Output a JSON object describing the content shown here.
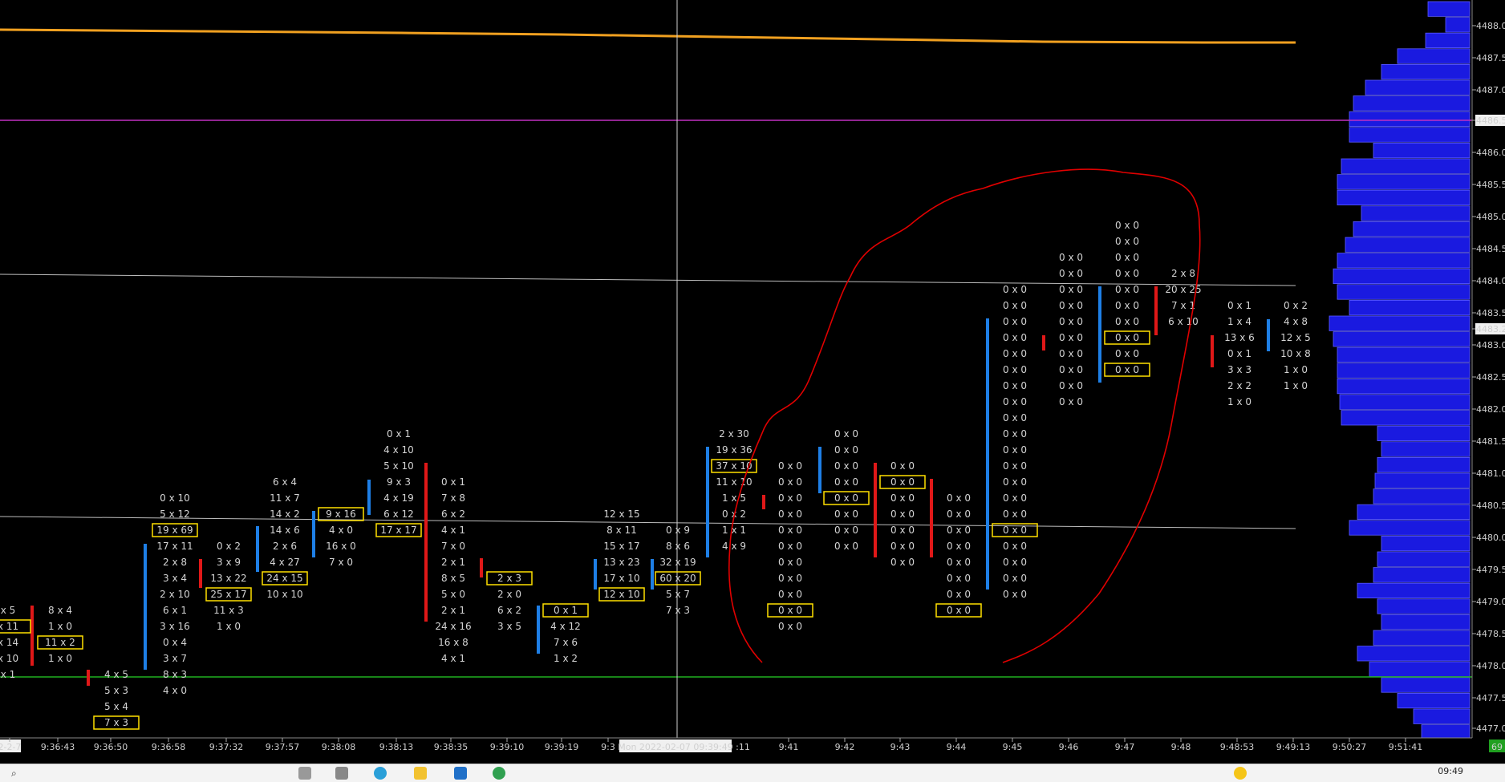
{
  "price_axis": {
    "labels": [
      "4488.00",
      "4487.50",
      "4487.00",
      "4486.50",
      "4486.00",
      "4485.50",
      "4485.00",
      "4484.50",
      "4484.00",
      "4483.50",
      "4483.25",
      "4483.00",
      "4482.50",
      "4482.00",
      "4481.50",
      "4481.00",
      "4480.50",
      "4480.00",
      "4479.50",
      "4479.00",
      "4478.50",
      "4478.00",
      "4477.50",
      "4477.00"
    ],
    "highlight_labels": [
      "4486.50",
      "4483.25"
    ]
  },
  "time_axis": {
    "labels": [
      "2-2-7",
      "9:36:43",
      "9:36:50",
      "9:36:58",
      "9:37:32",
      "9:37:57",
      "9:38:08",
      "9:38:13",
      "9:38:35",
      "9:39:10",
      "9:39:19",
      "9:3",
      "9:41",
      "9:42",
      "9:43",
      "9:44",
      "9:45",
      "9:46",
      "9:47",
      "9:48",
      "9:48:53",
      "9:49:13",
      "9:50:27",
      "9:51:41"
    ],
    "crosshair_label": "Mon 2022-02-07  09:39:49",
    "crosshair_suffix": ":11",
    "corner_badge": "69"
  },
  "colors": {
    "background": "#000000",
    "up_bar": "#1e7fe6",
    "down_bar": "#e01818",
    "poc_box": "#ffe000",
    "orange_line": "#f0a020",
    "magenta_line": "#c030c0",
    "green_line": "#20b020",
    "volume_profile": "#1a1ae0",
    "annotation": "#e00000"
  },
  "cells": [
    {
      "t": "x 5",
      "c": "w"
    },
    {
      "t": "x 11",
      "c": "w"
    },
    {
      "t": "x 14",
      "c": "w"
    },
    {
      "t": "x 10",
      "c": "w"
    },
    {
      "t": "x 1",
      "c": "g"
    },
    {
      "t": "8 x 4",
      "c": "w"
    },
    {
      "t": "1 x 0",
      "c": "w"
    },
    {
      "t": "11 x 2",
      "c": "r"
    },
    {
      "t": "1 x 0",
      "c": "w"
    },
    {
      "t": "4 x 5",
      "c": "g"
    },
    {
      "t": "5 x 3",
      "c": "w"
    },
    {
      "t": "5 x 4",
      "c": "w"
    },
    {
      "t": "7 x 3",
      "c": "w"
    },
    {
      "t": "0 x 10",
      "c": "w"
    },
    {
      "t": "5 x 12",
      "c": "w"
    },
    {
      "t": "19 x 69",
      "c": "w"
    },
    {
      "t": "17 x 11",
      "c": "g"
    },
    {
      "t": "2 x 8",
      "c": "w"
    },
    {
      "t": "3 x 4",
      "c": "w"
    },
    {
      "t": "2 x 10",
      "c": "w"
    },
    {
      "t": "6 x 1",
      "c": "w"
    },
    {
      "t": "3 x 16",
      "c": "g"
    },
    {
      "t": "0 x 4",
      "c": "w"
    },
    {
      "t": "3 x 7",
      "c": "w"
    },
    {
      "t": "8 x 3",
      "c": "w"
    },
    {
      "t": "4 x 0",
      "c": "w"
    },
    {
      "t": "0 x 2",
      "c": "w"
    },
    {
      "t": "3 x 9",
      "c": "w"
    },
    {
      "t": "13 x 22",
      "c": "w"
    },
    {
      "t": "25 x 17",
      "c": "w"
    },
    {
      "t": "11 x 3",
      "c": "w"
    },
    {
      "t": "1 x 0",
      "c": "w"
    },
    {
      "t": "6 x 4",
      "c": "w"
    },
    {
      "t": "11 x 7",
      "c": "w"
    },
    {
      "t": "14 x 2",
      "c": "w"
    },
    {
      "t": "14 x 6",
      "c": "r"
    },
    {
      "t": "2 x 6",
      "c": "w"
    },
    {
      "t": "4 x 27",
      "c": "w"
    },
    {
      "t": "24 x 15",
      "c": "w"
    },
    {
      "t": "10 x 10",
      "c": "w"
    },
    {
      "t": "9 x 16",
      "c": "w"
    },
    {
      "t": "4 x 0",
      "c": "w"
    },
    {
      "t": "16 x 0",
      "c": "r"
    },
    {
      "t": "7 x 0",
      "c": "r"
    },
    {
      "t": "0 x 1",
      "c": "w"
    },
    {
      "t": "4 x 10",
      "c": "w"
    },
    {
      "t": "5 x 10",
      "c": "w"
    },
    {
      "t": "9 x 3",
      "c": "w"
    },
    {
      "t": "4 x 19",
      "c": "w"
    },
    {
      "t": "6 x 12",
      "c": "w"
    },
    {
      "t": "17 x 17",
      "c": "w"
    },
    {
      "t": "0 x 1",
      "c": "w"
    },
    {
      "t": "7 x 8",
      "c": "r"
    },
    {
      "t": "6 x 2",
      "c": "w"
    },
    {
      "t": "4 x 1",
      "c": "w"
    },
    {
      "t": "7 x 0",
      "c": "r"
    },
    {
      "t": "2 x 1",
      "c": "r"
    },
    {
      "t": "8 x 5",
      "c": "r"
    },
    {
      "t": "5 x 0",
      "c": "w"
    },
    {
      "t": "2 x 1",
      "c": "r"
    },
    {
      "t": "24 x 16",
      "c": "r"
    },
    {
      "t": "16 x 8",
      "c": "w"
    },
    {
      "t": "4 x 1",
      "c": "w"
    },
    {
      "t": "2 x 3",
      "c": "w"
    },
    {
      "t": "2 x 0",
      "c": "w"
    },
    {
      "t": "6 x 2",
      "c": "r"
    },
    {
      "t": "3 x 5",
      "c": "w"
    },
    {
      "t": "0 x 1",
      "c": "w"
    },
    {
      "t": "4 x 12",
      "c": "w"
    },
    {
      "t": "7 x 6",
      "c": "g"
    },
    {
      "t": "1 x 2",
      "c": "w"
    },
    {
      "t": "12 x 15",
      "c": "w"
    },
    {
      "t": "8 x 11",
      "c": "w"
    },
    {
      "t": "15 x 17",
      "c": "w"
    },
    {
      "t": "13 x 23",
      "c": "w"
    },
    {
      "t": "17 x 10",
      "c": "w"
    },
    {
      "t": "12 x 10",
      "c": "w"
    },
    {
      "t": "0 x 9",
      "c": "w"
    },
    {
      "t": "8 x 6",
      "c": "w"
    },
    {
      "t": "32 x 19",
      "c": "r"
    },
    {
      "t": "60 x 20",
      "c": "w"
    },
    {
      "t": "5 x 7",
      "c": "w"
    },
    {
      "t": "7 x 3",
      "c": "w"
    },
    {
      "t": "2 x 30",
      "c": "w"
    },
    {
      "t": "19 x 36",
      "c": "w"
    },
    {
      "t": "37 x 10",
      "c": "w"
    },
    {
      "t": "11 x 10",
      "c": "g"
    },
    {
      "t": "1 x 5",
      "c": "g"
    },
    {
      "t": "0 x 2",
      "c": "w"
    },
    {
      "t": "1 x 1",
      "c": "w"
    },
    {
      "t": "4 x 9",
      "c": "w"
    },
    {
      "t": "0 x 0",
      "c": "w"
    },
    {
      "t": "0 x 0",
      "c": "w"
    },
    {
      "t": "0 x 0",
      "c": "w"
    },
    {
      "t": "0 x 0",
      "c": "w"
    },
    {
      "t": "0 x 0",
      "c": "w"
    },
    {
      "t": "0 x 0",
      "c": "w"
    },
    {
      "t": "0 x 0",
      "c": "w"
    },
    {
      "t": "0 x 0",
      "c": "w"
    },
    {
      "t": "0 x 0",
      "c": "w"
    },
    {
      "t": "0 x 0",
      "c": "w"
    },
    {
      "t": "0 x 0",
      "c": "w"
    },
    {
      "t": "0 x 0",
      "c": "w"
    },
    {
      "t": "0 x 0",
      "c": "w"
    },
    {
      "t": "0 x 0",
      "c": "w"
    },
    {
      "t": "0 x 0",
      "c": "w"
    },
    {
      "t": "0 x 0",
      "c": "w"
    },
    {
      "t": "0 x 0",
      "c": "w"
    },
    {
      "t": "0 x 0",
      "c": "w"
    },
    {
      "t": "0 x 0",
      "c": "w"
    },
    {
      "t": "0 x 0",
      "c": "w"
    },
    {
      "t": "0 x 0",
      "c": "w"
    },
    {
      "t": "0 x 0",
      "c": "w"
    },
    {
      "t": "0 x 0",
      "c": "w"
    },
    {
      "t": "0 x 0",
      "c": "w"
    },
    {
      "t": "0 x 0",
      "c": "w"
    },
    {
      "t": "0 x 0",
      "c": "w"
    },
    {
      "t": "0 x 0",
      "c": "w"
    },
    {
      "t": "0 x 0",
      "c": "w"
    },
    {
      "t": "0 x 0",
      "c": "w"
    },
    {
      "t": "0 x 0",
      "c": "w"
    },
    {
      "t": "0 x 0",
      "c": "w"
    },
    {
      "t": "0 x 0",
      "c": "w"
    },
    {
      "t": "0 x 0",
      "c": "w"
    },
    {
      "t": "0 x 0",
      "c": "w"
    },
    {
      "t": "0 x 0",
      "c": "w"
    },
    {
      "t": "0 x 0",
      "c": "w"
    },
    {
      "t": "0 x 0",
      "c": "w"
    },
    {
      "t": "0 x 0",
      "c": "w"
    },
    {
      "t": "0 x 0",
      "c": "w"
    },
    {
      "t": "0 x 0",
      "c": "w"
    },
    {
      "t": "0 x 0",
      "c": "w"
    },
    {
      "t": "0 x 0",
      "c": "w"
    },
    {
      "t": "0 x 0",
      "c": "w"
    },
    {
      "t": "0 x 0",
      "c": "w"
    },
    {
      "t": "0 x 0",
      "c": "w"
    },
    {
      "t": "0 x 0",
      "c": "w"
    },
    {
      "t": "0 x 0",
      "c": "w"
    },
    {
      "t": "0 x 0",
      "c": "w"
    },
    {
      "t": "0 x 0",
      "c": "w"
    },
    {
      "t": "0 x 0",
      "c": "w"
    },
    {
      "t": "0 x 0",
      "c": "w"
    },
    {
      "t": "0 x 0",
      "c": "w"
    },
    {
      "t": "0 x 0",
      "c": "w"
    },
    {
      "t": "0 x 0",
      "c": "w"
    },
    {
      "t": "0 x 0",
      "c": "w"
    },
    {
      "t": "0 x 0",
      "c": "w"
    },
    {
      "t": "0 x 0",
      "c": "w"
    },
    {
      "t": "0 x 0",
      "c": "w"
    },
    {
      "t": "0 x 0",
      "c": "w"
    },
    {
      "t": "0 x 0",
      "c": "w"
    },
    {
      "t": "0 x 0",
      "c": "w"
    },
    {
      "t": "0 x 0",
      "c": "w"
    },
    {
      "t": "0 x 0",
      "c": "w"
    },
    {
      "t": "0 x 0",
      "c": "w"
    },
    {
      "t": "0 x 0",
      "c": "w"
    },
    {
      "t": "0 x 0",
      "c": "w"
    },
    {
      "t": "0 x 0",
      "c": "w"
    },
    {
      "t": "0 x 0",
      "c": "w"
    },
    {
      "t": "0 x 0",
      "c": "w"
    },
    {
      "t": "0 x 0",
      "c": "w"
    },
    {
      "t": "0 x 0",
      "c": "w"
    },
    {
      "t": "0 x 0",
      "c": "w"
    },
    {
      "t": "0 x 0",
      "c": "w"
    },
    {
      "t": "0 x 0",
      "c": "w"
    },
    {
      "t": "2 x 8",
      "c": "w"
    },
    {
      "t": "20 x 25",
      "c": "w"
    },
    {
      "t": "7 x 1",
      "c": "w"
    },
    {
      "t": "6 x 10",
      "c": "r"
    },
    {
      "t": "0 x 1",
      "c": "w"
    },
    {
      "t": "1 x 4",
      "c": "w"
    },
    {
      "t": "13 x 6",
      "c": "g"
    },
    {
      "t": "0 x 1",
      "c": "w"
    },
    {
      "t": "3 x 3",
      "c": "w"
    },
    {
      "t": "2 x 2",
      "c": "w"
    },
    {
      "t": "1 x 0",
      "c": "w"
    },
    {
      "t": "0 x 2",
      "c": "w"
    },
    {
      "t": "4 x 8",
      "c": "w"
    },
    {
      "t": "12 x 5",
      "c": "w"
    },
    {
      "t": "10 x 8",
      "c": "g"
    },
    {
      "t": "1 x 0",
      "c": "w"
    },
    {
      "t": "1 x 0",
      "c": "r"
    }
  ]
}
